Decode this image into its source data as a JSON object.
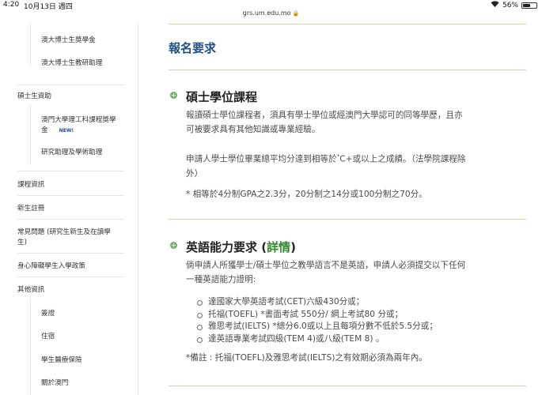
{
  "status_bar": {
    "time": "4:20",
    "date": "10月13日 週四",
    "battery": "56%",
    "battery_level": 0.56
  },
  "browser": {
    "url": "grs.um.edu.mo"
  },
  "sidebar": {
    "items": [
      {
        "label": "澳大博士生獎學金"
      },
      {
        "label": "澳大博士生教研助理"
      },
      {
        "label": "碩士生資助"
      },
      {
        "label_line1": "澳門大學理工科課程獎學",
        "label_line2": "金",
        "badge": "NEW!"
      },
      {
        "label": "研究助理及學術助理"
      },
      {
        "label": "課程資訊"
      },
      {
        "label": "新生註冊"
      },
      {
        "label_line1": "常見問題 (研究生新生及在讀學",
        "label_line2": "生)"
      },
      {
        "label": "身心障礙學生入學政策"
      },
      {
        "label": "其他資訊"
      },
      {
        "label": "簽證"
      },
      {
        "label": "住宿"
      },
      {
        "label": "學生醫療保險"
      },
      {
        "label": "關於澳門"
      }
    ]
  },
  "main": {
    "title": "報名要求",
    "sections": [
      {
        "title": "碩士學位課程",
        "paragraphs": [
          {
            "line1": "報讀碩士學位課程者，須具有學士學位或經澳門大學認可的同等學歷，且亦",
            "line2": "可被要求具有其他知識或專業經驗。"
          },
          {
            "line1_pre": "申請人學士學位畢業總平均分達到相等於",
            "line1_sup": "*",
            "line1_post": "C+或以上之成績。（法學院課程除",
            "line2": "外）"
          },
          {
            "line1": "* 相等於4分制GPA之2.3分，20分制之14分或100分制之70分。"
          }
        ]
      },
      {
        "title_pre": "英語能力要求 (",
        "title_link": "詳情",
        "title_post": ")",
        "intro_line1": "倘申請人所獲學士/碩士學位之教學語言不是英語，申請人必須提交以下任何",
        "intro_line2": "一種英語能力證明:",
        "items": [
          "達國家大學英語考試(CET)六級430分或；",
          "托福(TOEFL) *書面考試 550分/ 網上考試80 分或；",
          "雅思考試(IELTS) *總分6.0或以上且每項分數不低於5.5分或；",
          "達英語專業考試四級(TEM 4)或八級(TEM 8) 。"
        ],
        "note": "*備註 : 托福(TOEFL)及雅思考試(IELTS)之有效期必須為兩年內。"
      }
    ]
  },
  "colors": {
    "title_blue": "#1d4f84",
    "accent_green": "#6bb65f",
    "link_green": "#2f8a2f",
    "rule_green": "#c7d9a4"
  }
}
